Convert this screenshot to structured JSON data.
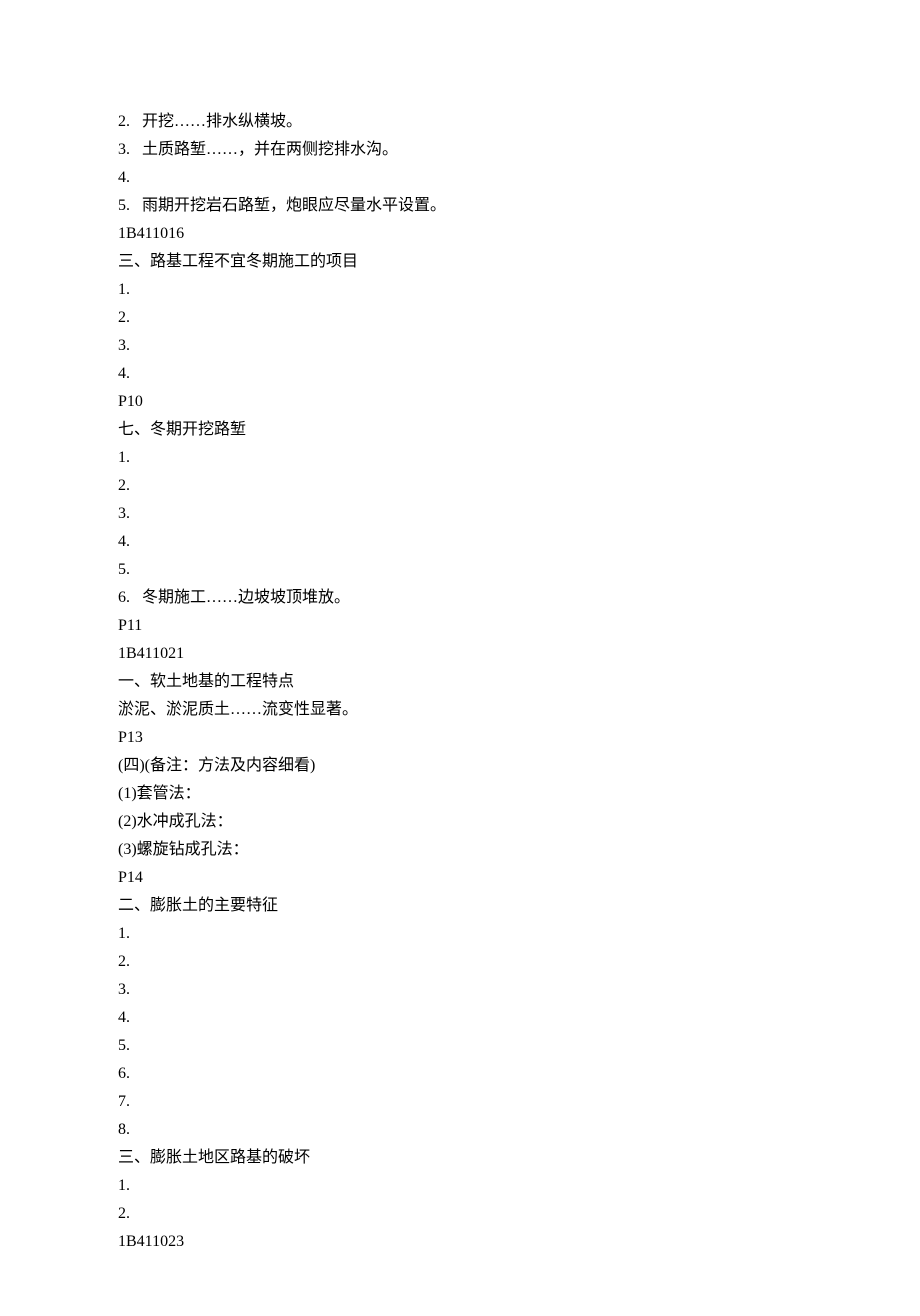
{
  "lines": [
    "2.   开挖……排水纵横坡。",
    "3.   土质路堑……，并在两侧挖排水沟。",
    "4.",
    "5.   雨期开挖岩石路堑，炮眼应尽量水平设置。",
    "1B411016",
    "三、路基工程不宜冬期施工的项目",
    "1.",
    "2.",
    "3.",
    "4.",
    "P10",
    "七、冬期开挖路堑",
    "1.",
    "2.",
    "3.",
    "4.",
    "5.",
    "6.   冬期施工……边坡坡顶堆放。",
    "P11",
    "1B411021",
    "一、软土地基的工程特点",
    "淤泥、淤泥质土……流变性显著。",
    "P13",
    "(四)(备注：方法及内容细看)",
    "(1)套管法：",
    "(2)水冲成孔法：",
    "(3)螺旋钻成孔法：",
    "P14",
    "二、膨胀土的主要特征",
    "1.",
    "2.",
    "3.",
    "4.",
    "5.",
    "6.",
    "7.",
    "8.",
    "三、膨胀土地区路基的破坏",
    "1.",
    "2.",
    "1B411023"
  ]
}
